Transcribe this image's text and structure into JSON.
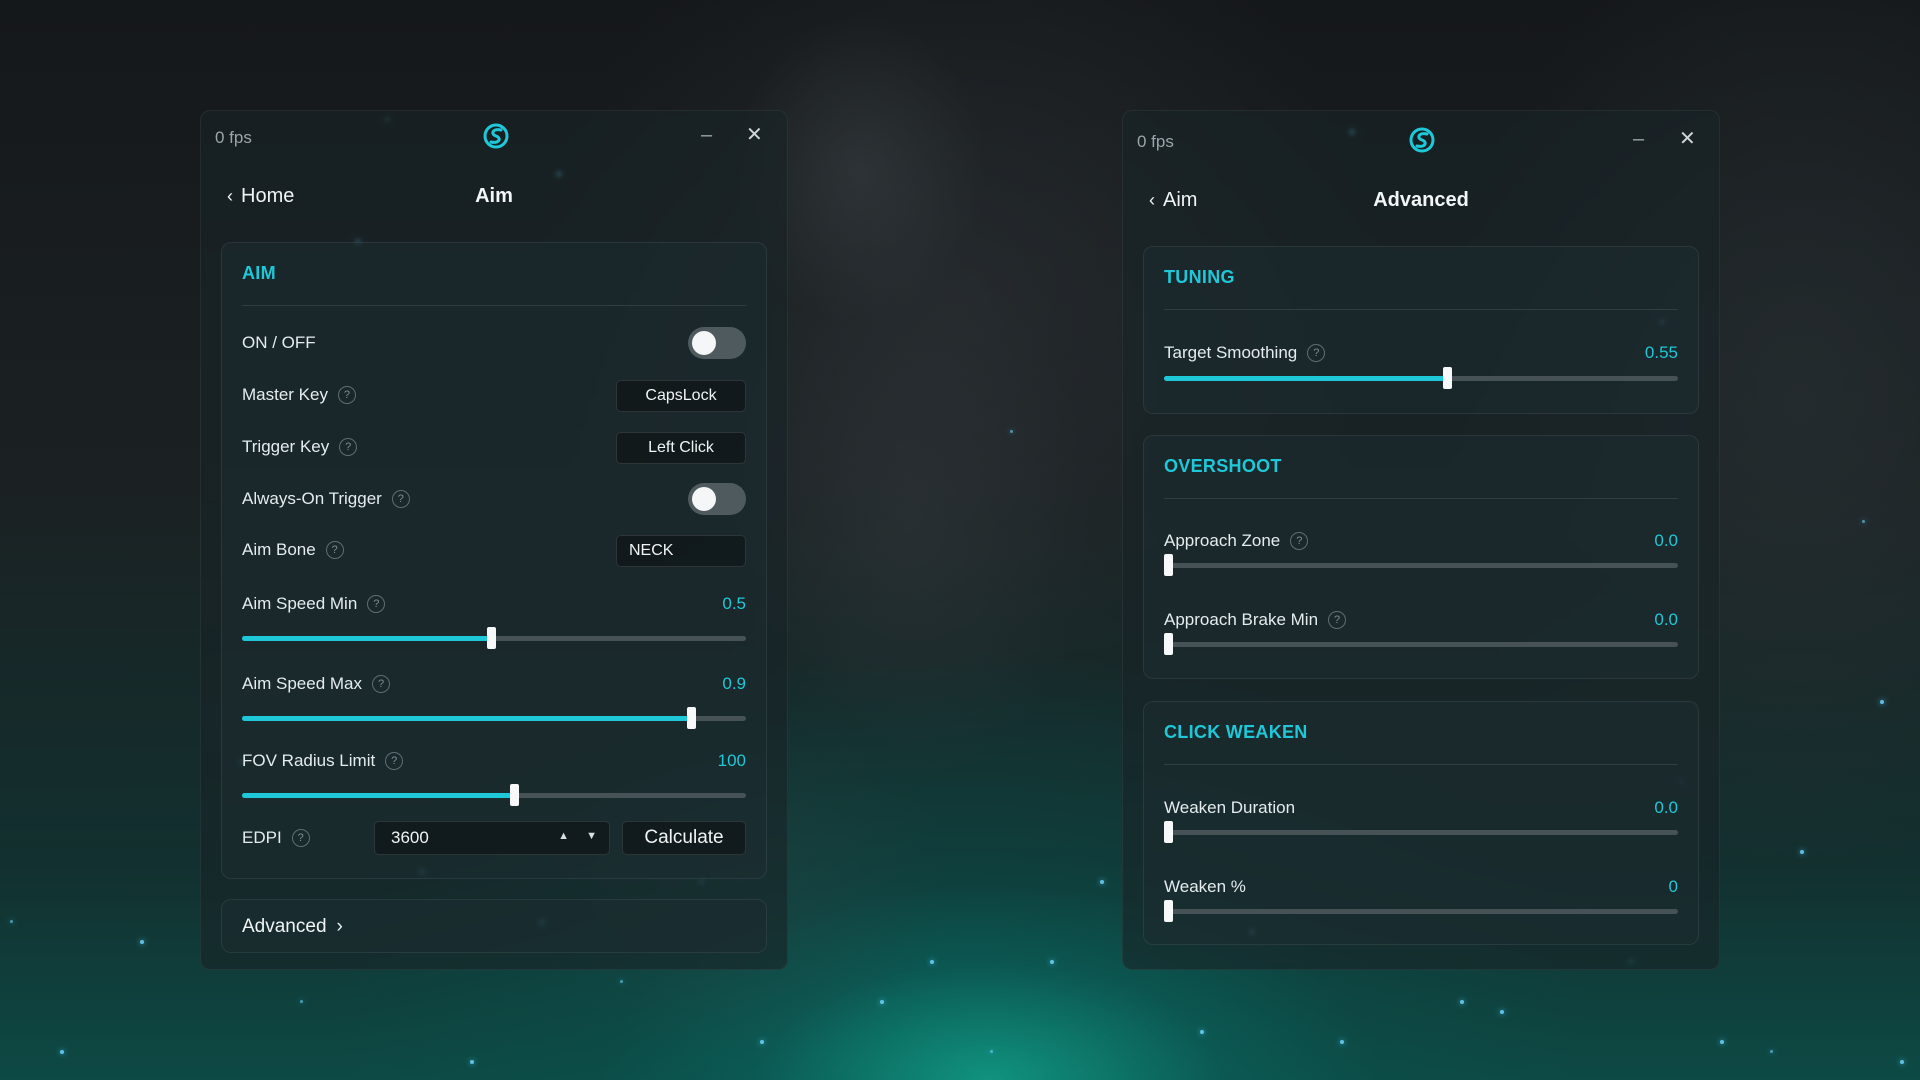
{
  "colors": {
    "accent": "#1fc8d8",
    "track": "#465256",
    "toggle_off": "#4e5a5e"
  },
  "left_window": {
    "fps": "0 fps",
    "back_label": "Home",
    "title": "Aim",
    "aim_card": {
      "heading": "AIM",
      "on_off": {
        "label": "ON / OFF",
        "enabled": false
      },
      "master_key": {
        "label": "Master Key",
        "value": "CapsLock"
      },
      "trigger_key": {
        "label": "Trigger Key",
        "value": "Left Click"
      },
      "always_on_trigger": {
        "label": "Always-On Trigger",
        "enabled": false
      },
      "aim_bone": {
        "label": "Aim Bone",
        "value": "NECK"
      },
      "aim_speed_min": {
        "label": "Aim Speed Min",
        "value": "0.5",
        "fraction": 0.495
      },
      "aim_speed_max": {
        "label": "Aim Speed Max",
        "value": "0.9",
        "fraction": 0.89
      },
      "fov_radius_limit": {
        "label": "FOV Radius Limit",
        "value": "100",
        "fraction": 0.54
      },
      "edpi": {
        "label": "EDPI",
        "value": "3600",
        "calculate_label": "Calculate"
      }
    },
    "advanced_link": "Advanced"
  },
  "right_window": {
    "fps": "0 fps",
    "back_label": "Aim",
    "title": "Advanced",
    "tuning": {
      "heading": "TUNING",
      "target_smoothing": {
        "label": "Target Smoothing",
        "value": "0.55",
        "fraction": 0.55
      }
    },
    "overshoot": {
      "heading": "OVERSHOOT",
      "approach_zone": {
        "label": "Approach Zone",
        "value": "0.0",
        "fraction": 0
      },
      "approach_brake_min": {
        "label": "Approach Brake Min",
        "value": "0.0",
        "fraction": 0
      }
    },
    "click_weaken": {
      "heading": "CLICK WEAKEN",
      "weaken_duration": {
        "label": "Weaken Duration",
        "value": "0.0",
        "fraction": 0
      },
      "weaken_percent": {
        "label": "Weaken %",
        "value": "0",
        "fraction": 0
      }
    }
  }
}
